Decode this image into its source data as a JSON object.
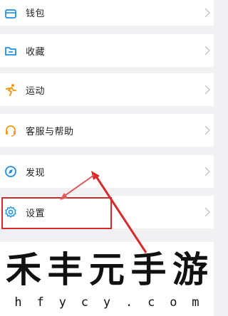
{
  "menu": {
    "items": [
      {
        "label": "钱包",
        "icon": "wallet-icon"
      },
      {
        "label": "收藏",
        "icon": "folder-icon"
      },
      {
        "label": "运动",
        "icon": "running-icon"
      },
      {
        "label": "客服与帮助",
        "icon": "headset-icon"
      },
      {
        "label": "发现",
        "icon": "compass-icon"
      },
      {
        "label": "设置",
        "icon": "gear-icon"
      }
    ]
  },
  "annotation": {
    "color": "#d62b2b"
  },
  "watermark": {
    "title_chars": [
      "禾",
      "丰",
      "元",
      "手",
      "游"
    ],
    "subtitle_chars": [
      "h",
      "f",
      "y",
      "c",
      "y",
      ".",
      "c",
      "o",
      "m"
    ]
  },
  "colors": {
    "accent_blue": "#1f8fe8",
    "accent_orange": "#f09a16",
    "background": "#f1f1f3"
  }
}
